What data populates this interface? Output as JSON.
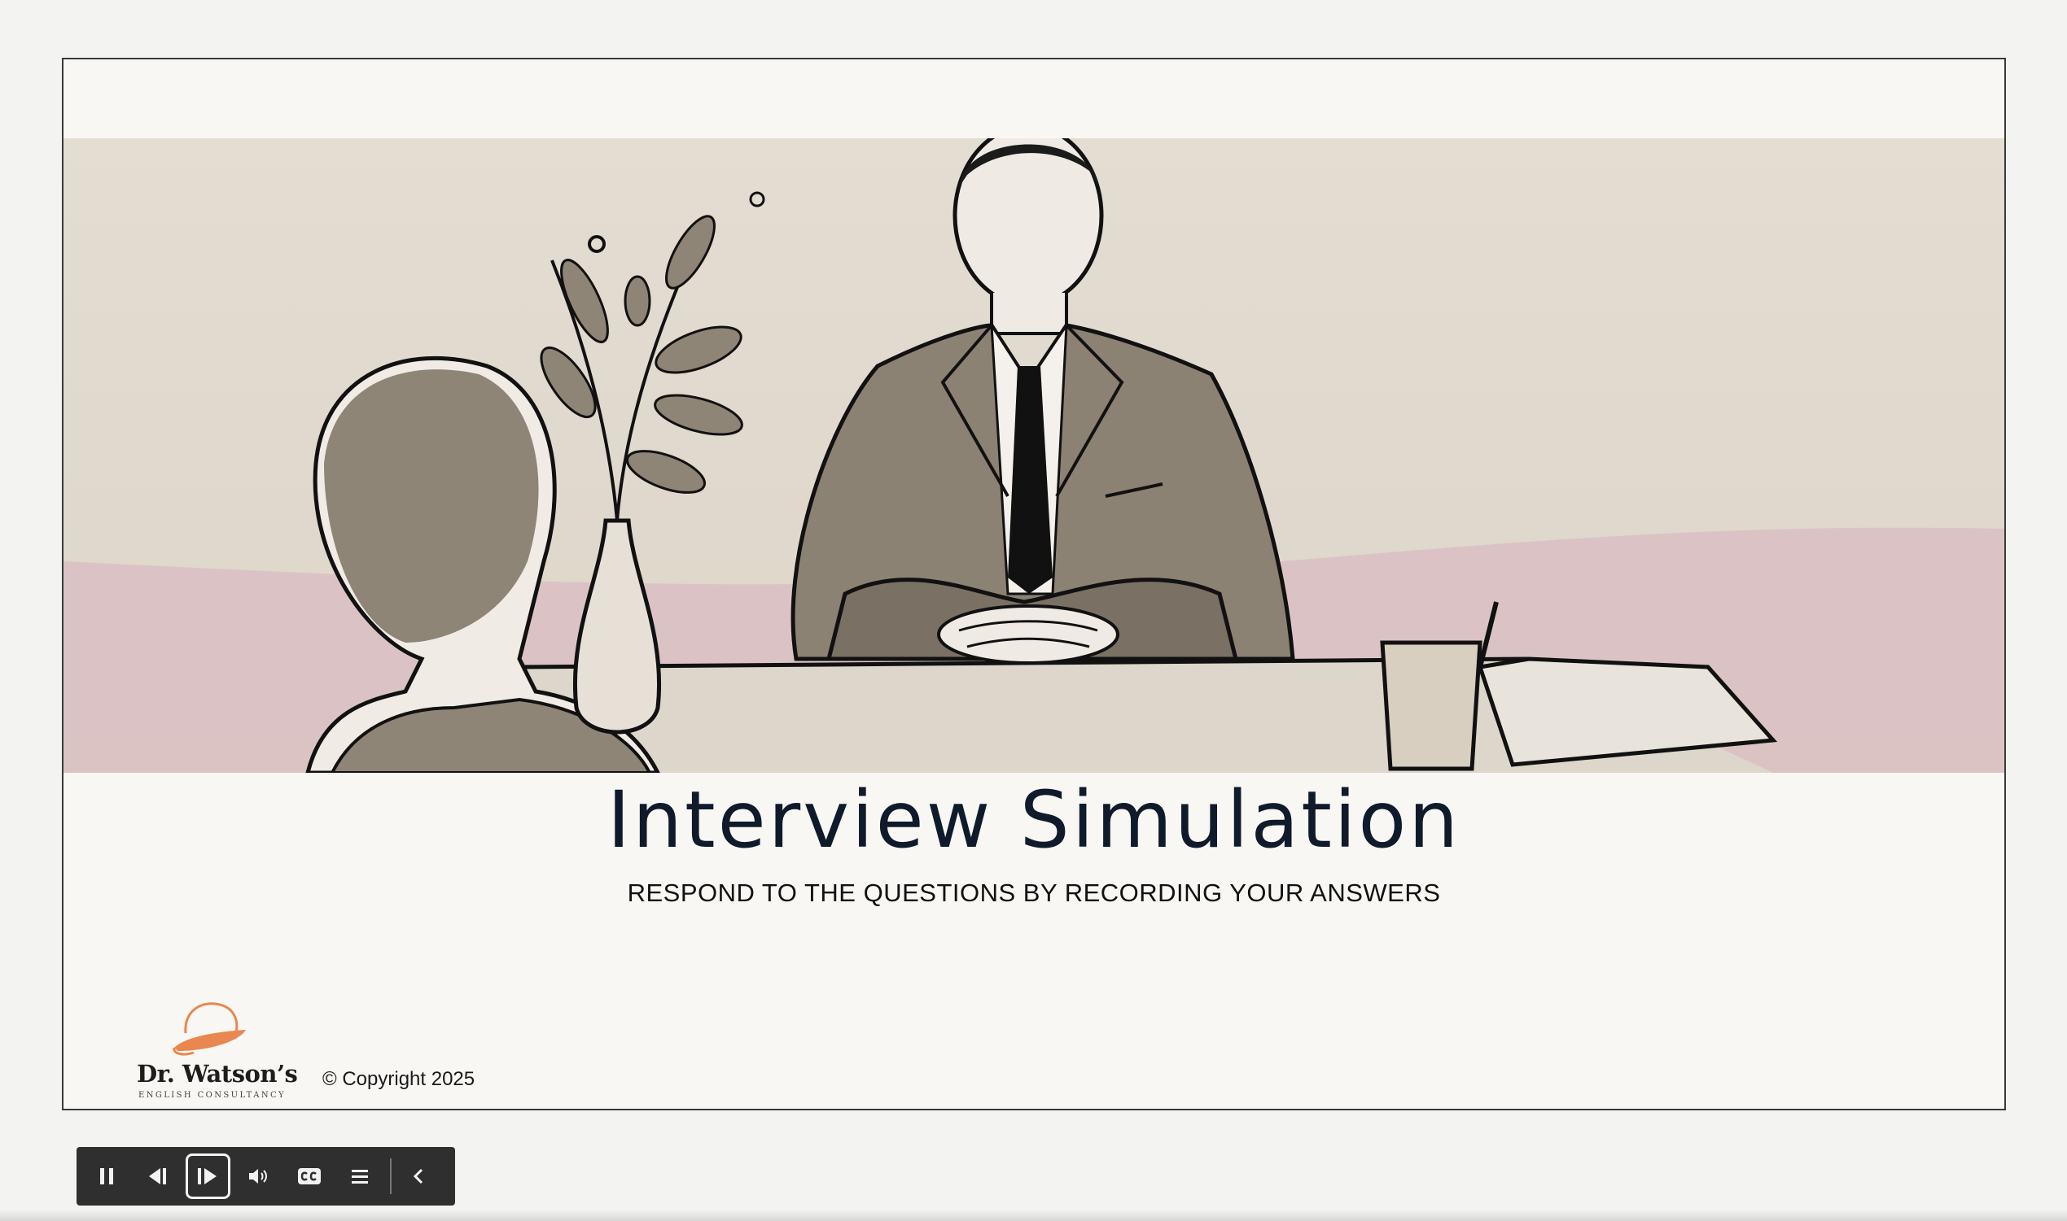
{
  "slide": {
    "title": "Interview Simulation",
    "subtitle": "RESPOND TO THE QUESTIONS BY RECORDING YOUR ANSWERS",
    "copyright": "© Copyright 2025"
  },
  "logo": {
    "name": "Dr. Watson’s",
    "tagline": "ENGLISH CONSULTANCY",
    "icon": "bowler-hat-icon",
    "accent_color": "#e8874f"
  },
  "player_controls": {
    "buttons": [
      {
        "id": "pause",
        "icon": "pause-icon"
      },
      {
        "id": "previous",
        "icon": "previous-icon"
      },
      {
        "id": "next",
        "icon": "next-icon",
        "active": true
      },
      {
        "id": "volume",
        "icon": "volume-icon"
      },
      {
        "id": "captions",
        "icon": "closed-captions-icon"
      },
      {
        "id": "menu",
        "icon": "menu-icon"
      },
      {
        "id": "collapse",
        "icon": "chevron-left-icon"
      }
    ]
  },
  "colors": {
    "slide_background": "#f8f7f3",
    "title_text": "#0f1a2b",
    "controls_background": "#2f2f2f"
  }
}
